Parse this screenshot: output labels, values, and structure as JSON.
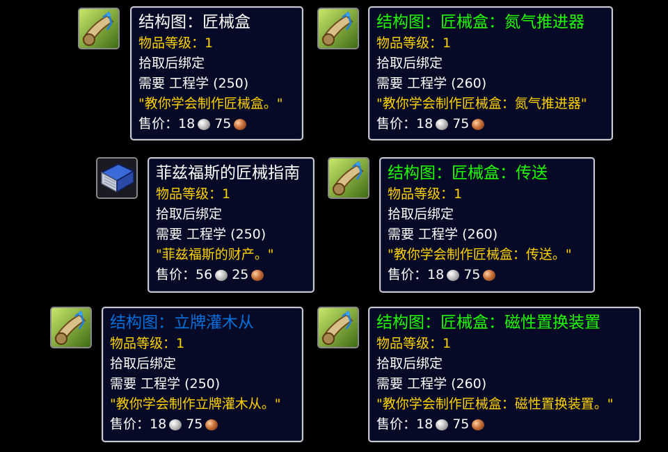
{
  "tooltips": [
    {
      "icon": "schematic-scroll-icon",
      "title": "结构图：匠械盒",
      "title_color": "#ffffff",
      "item_level": "物品等级：1",
      "binding": "拾取后绑定",
      "requirement": "需要 工程学 (250)",
      "flavor": "\"教你学会制作匠械盒。\"",
      "price_label": "售价：",
      "silver": "18",
      "copper": "75"
    },
    {
      "icon": "schematic-scroll-icon",
      "title": "结构图：匠械盒：氮气推进器",
      "title_color": "#1eff00",
      "item_level": "物品等级：1",
      "binding": "拾取后绑定",
      "requirement": "需要 工程学 (260)",
      "flavor": "\"教你学会制作匠械盒：氮气推进器\"",
      "price_label": "售价：",
      "silver": "18",
      "copper": "75"
    },
    {
      "icon": "book-icon",
      "title": "菲兹福斯的匠械指南",
      "title_color": "#ffffff",
      "item_level": "物品等级：1",
      "binding": "拾取后绑定",
      "requirement": "需要 工程学 (250)",
      "flavor": "\"菲兹福斯的财产。\"",
      "price_label": "售价：",
      "silver": "56",
      "copper": "25"
    },
    {
      "icon": "schematic-scroll-icon",
      "title": "结构图：匠械盒：传送",
      "title_color": "#1eff00",
      "item_level": "物品等级：1",
      "binding": "拾取后绑定",
      "requirement": "需要 工程学 (260)",
      "flavor": "\"教你学会制作匠械盒：传送。\"",
      "price_label": "售价：",
      "silver": "18",
      "copper": "75"
    },
    {
      "icon": "schematic-scroll-icon",
      "title": "结构图：立牌灌木从",
      "title_color": "#0070dd",
      "item_level": "物品等级：1",
      "binding": "拾取后绑定",
      "requirement": "需要 工程学 (250)",
      "flavor": "\"教你学会制作立牌灌木从。\"",
      "price_label": "售价：",
      "silver": "18",
      "copper": "75"
    },
    {
      "icon": "schematic-scroll-icon",
      "title": "结构图：匠械盒：磁性置换装置",
      "title_color": "#1eff00",
      "item_level": "物品等级：1",
      "binding": "拾取后绑定",
      "requirement": "需要 工程学 (260)",
      "flavor": "\"教你学会制作匠械盒：磁性置换装置。\"",
      "price_label": "售价：",
      "silver": "18",
      "copper": "75"
    }
  ]
}
